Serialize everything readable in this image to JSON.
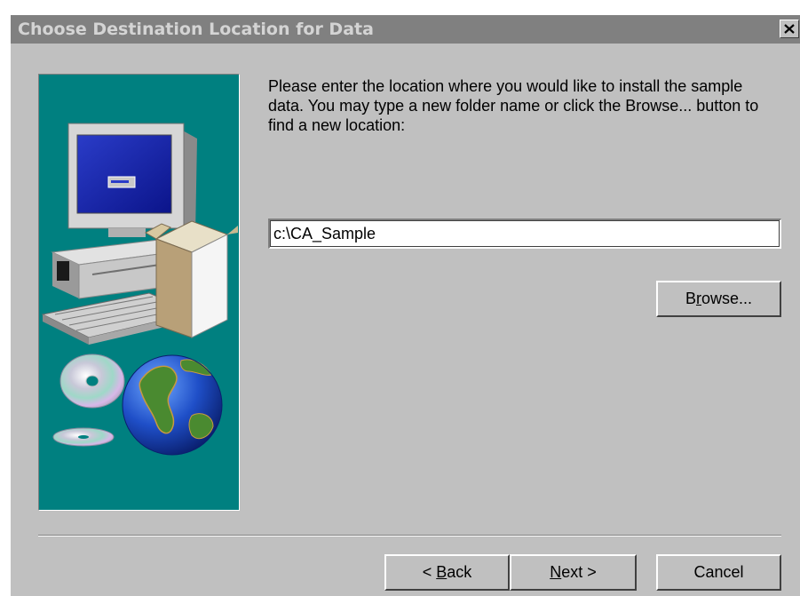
{
  "window": {
    "title": "Choose Destination Location for Data"
  },
  "content": {
    "instructions": "Please enter the location where you would like to install the sample data.  You may type a new folder name or click the Browse... button to find a new location:",
    "path_value": "c:\\CA_Sample"
  },
  "buttons": {
    "browse": {
      "prefix": "B",
      "mnemonic": "r",
      "suffix": "owse..."
    },
    "back": {
      "prefix": "< ",
      "mnemonic": "B",
      "suffix": "ack"
    },
    "next": {
      "prefix": "",
      "mnemonic": "N",
      "suffix": "ext >"
    },
    "cancel": "Cancel"
  },
  "icons": {
    "close": "close-icon",
    "illustration": [
      "computer-icon",
      "software-box-icon",
      "cd-icon",
      "globe-icon"
    ]
  },
  "colors": {
    "dialog_bg": "#c0c0c0",
    "titlebar_inactive": "#808080",
    "panel_teal": "#008080"
  }
}
